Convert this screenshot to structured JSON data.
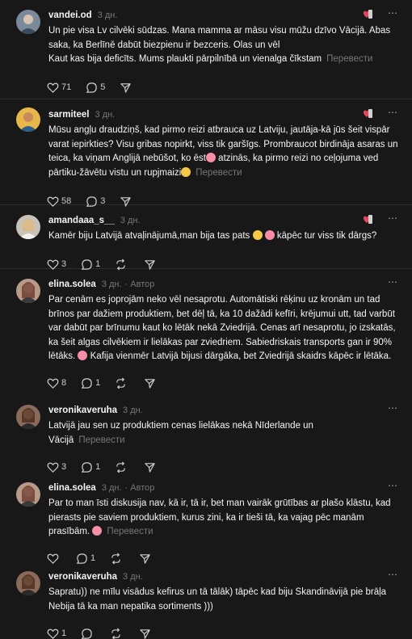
{
  "ui": {
    "translate": "Перевести",
    "author_badge": "Автор"
  },
  "posts": [
    {
      "user": "vandei.od",
      "time": "3 дн.",
      "text": "Un pie visa Lv cilvēki sūdzas. Mana mamma ar māsu visu mūžu dzīvo Vācijā. Abas saka, ka Berlīnē dabūt biezpienu ir bezceris. Olas un vēl\nKaut kas bija deficīts. Mums plaukti pārpilnībā un vienalga čīkstam",
      "likes": "71",
      "comments": "5",
      "reposts": ""
    },
    {
      "user": "sarmiteel",
      "time": "3 дн.",
      "text_a": "Mūsu angļu draudziņš, kad pirmo reizi atbrauca uz Latviju, jautāja-kā jūs šeit vispār varat iepirkties? Visu gribas nopirkt, viss tik garšīgs. Prombraucot birdināja asaras un teica, ka viņam Anglijā nebūšot, ko ēst",
      "text_b": " atzinās, ka pirmo reizi no ceļojuma ved pārtiku-žāvētu vistu un rupjmaizi",
      "likes": "58",
      "comments": "3",
      "reposts": ""
    },
    {
      "user": "amandaaa_s__",
      "time": "3 дн.",
      "text_a": "Kamēr biju Latvijā atvaļinājumā,man bija tas pats ",
      "text_b": " kāpēc tur viss tik dārgs?",
      "likes": "3",
      "comments": "1",
      "reposts": ""
    },
    {
      "user": "elina.solea",
      "time": "3 дн.",
      "text_a": "Par cenām es joprojām neko vēl nesaprotu. Automātiski rēķinu uz kronām un tad brīnos par dažiem produktiem, bet dēļ tā, ka 10 dažādi kefīri, krējumui utt, tad varbūt var dabūt par brīnumu kaut ko lētāk nekā Zviedrijā. Cenas arī nesaprotu, jo izskatās, ka šeit algas cilvēkiem ir lielākas par zviedriem. Sabiedriskais transports gan ir 90% lētāks. ",
      "text_b": " Kafija vienmēr Latvijā bijusi dārgāka, bet Zviedrijā skaidrs kāpēc ir lētāka.",
      "likes": "8",
      "comments": "1",
      "reposts": ""
    },
    {
      "user": "veronikaveruha",
      "time": "3 дн.",
      "text": "Latvijā jau sen uz produktiem cenas lielākas nekā Nīderlande un\nVācijā",
      "likes": "3",
      "comments": "1",
      "reposts": ""
    },
    {
      "user": "elina.solea",
      "time": "3 дн.",
      "text": "Par to man īsti diskusija nav, kā ir, tā ir, bet man vairāk grūtības ar plašo klāstu, kad pierasts pie saviem produktiem, kurus zini, ka ir tieši tā, ka vajag pēc manām prasībām. ",
      "likes": "",
      "comments": "1",
      "reposts": ""
    },
    {
      "user": "veronikaveruha",
      "time": "3 дн.",
      "text": "Sapratu)) ne mīlu visādus kefirus un tā tālāk) tāpēc kad biju Skandināvijā pie brāļa\nNebija tā ka man nepatika sortiments )))",
      "likes": "1",
      "comments": "",
      "reposts": ""
    }
  ],
  "colors": {
    "background": "#181818",
    "text": "#f3f5f7",
    "muted": "#777777",
    "divider": "#2e2e2e"
  }
}
